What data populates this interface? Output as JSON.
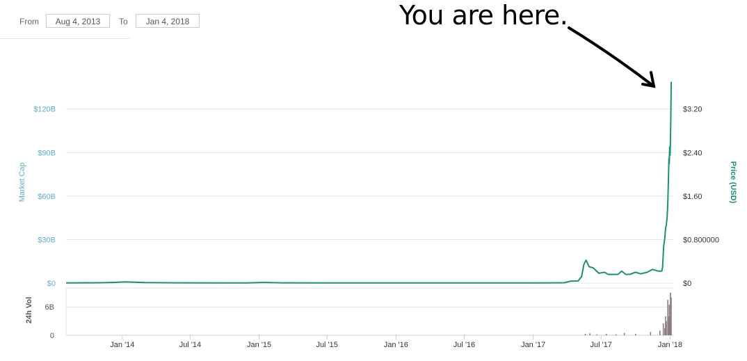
{
  "date_range": {
    "from_label": "From",
    "from_value": "Aug 4, 2013",
    "to_label": "To",
    "to_value": "Jan 4, 2018"
  },
  "annotation": {
    "text": "You are here."
  },
  "colors": {
    "price_line": "#1a8f77",
    "market_cap_axis": "#5bb0cb",
    "volume_bars": "#8c7f7f",
    "grid": "#e6e6e6"
  },
  "chart_data": {
    "type": "line",
    "title": "",
    "x_range": [
      "2013-08-04",
      "2018-01-04"
    ],
    "x_ticks": [
      "Jan '14",
      "Jul '14",
      "Jan '15",
      "Jul '15",
      "Jan '16",
      "Jul '16",
      "Jan '17",
      "Jul '17",
      "Jan '18"
    ],
    "left_axis": {
      "label": "Market Cap",
      "ticks": [
        "$0",
        "$30B",
        "$60B",
        "$90B",
        "$120B"
      ],
      "values": [
        0,
        30,
        60,
        90,
        120
      ],
      "unit": "B"
    },
    "right_axis": {
      "label": "Price (USD)",
      "ticks": [
        "$0",
        "$0.800000",
        "$1.60",
        "$2.40",
        "$3.20"
      ],
      "values": [
        0,
        0.8,
        1.6,
        2.4,
        3.2
      ]
    },
    "volume_axis": {
      "label": "24h Vol",
      "ticks": [
        "0",
        "6B"
      ],
      "values": [
        0,
        6
      ]
    },
    "grid": true,
    "series": [
      {
        "name": "Price (USD)",
        "x": [
          "2013-08-04",
          "2013-11-01",
          "2013-12-05",
          "2014-01-10",
          "2014-03-01",
          "2014-06-01",
          "2014-09-01",
          "2014-12-01",
          "2015-01-10",
          "2015-03-01",
          "2015-06-01",
          "2015-09-01",
          "2015-12-01",
          "2016-03-01",
          "2016-06-01",
          "2016-09-01",
          "2016-12-01",
          "2017-01-15",
          "2017-03-01",
          "2017-03-25",
          "2017-04-10",
          "2017-05-01",
          "2017-05-10",
          "2017-05-16",
          "2017-05-22",
          "2017-05-30",
          "2017-06-10",
          "2017-06-25",
          "2017-07-10",
          "2017-07-20",
          "2017-08-01",
          "2017-08-15",
          "2017-08-25",
          "2017-09-05",
          "2017-09-15",
          "2017-10-01",
          "2017-10-15",
          "2017-11-01",
          "2017-11-15",
          "2017-12-01",
          "2017-12-10",
          "2017-12-12",
          "2017-12-15",
          "2017-12-18",
          "2017-12-20",
          "2017-12-22",
          "2017-12-24",
          "2017-12-26",
          "2017-12-28",
          "2017-12-29",
          "2017-12-30",
          "2017-12-31",
          "2018-01-01",
          "2018-01-02",
          "2018-01-03",
          "2018-01-04"
        ],
        "y": [
          0.004,
          0.006,
          0.012,
          0.022,
          0.009,
          0.005,
          0.004,
          0.004,
          0.012,
          0.005,
          0.004,
          0.004,
          0.003,
          0.004,
          0.004,
          0.004,
          0.004,
          0.003,
          0.005,
          0.006,
          0.035,
          0.04,
          0.12,
          0.34,
          0.42,
          0.3,
          0.28,
          0.18,
          0.2,
          0.16,
          0.16,
          0.16,
          0.22,
          0.16,
          0.16,
          0.2,
          0.17,
          0.2,
          0.25,
          0.22,
          0.22,
          0.29,
          0.68,
          0.82,
          1.0,
          1.07,
          1.2,
          1.45,
          2.0,
          2.3,
          2.2,
          2.5,
          2.35,
          2.6,
          3.05,
          3.7
        ]
      }
    ],
    "volume": {
      "x": [
        "2017-05-20",
        "2017-06-01",
        "2017-06-20",
        "2017-07-15",
        "2017-08-10",
        "2017-09-01",
        "2017-10-01",
        "2017-11-10",
        "2017-12-05",
        "2017-12-14",
        "2017-12-18",
        "2017-12-20",
        "2017-12-22",
        "2017-12-26",
        "2017-12-28",
        "2017-12-30",
        "2018-01-01",
        "2018-01-02",
        "2018-01-03",
        "2018-01-04"
      ],
      "y": [
        0.3,
        0.4,
        0.2,
        0.3,
        0.2,
        0.5,
        0.3,
        0.7,
        1.0,
        2.5,
        1.5,
        4.0,
        3.0,
        7.5,
        4.0,
        6.5,
        3.5,
        9.0,
        5.5,
        8.0
      ]
    }
  }
}
